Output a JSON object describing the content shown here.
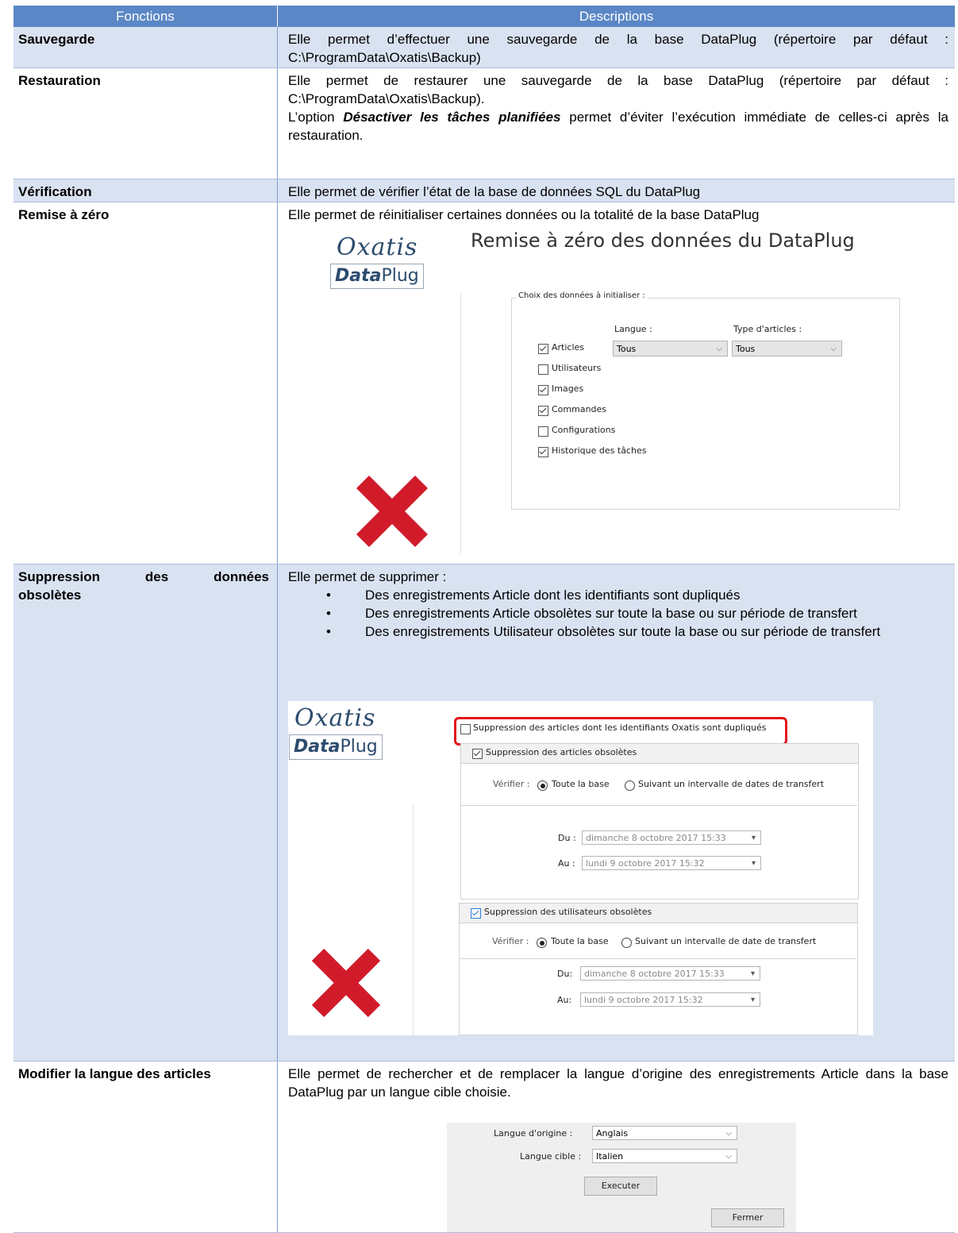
{
  "header": {
    "col1": "Fonctions",
    "col2": "Descriptions"
  },
  "rows": [
    {
      "function": "Sauvegarde",
      "lines": [
        "Elle permet d’effectuer une sauvegarde de la base DataPlug (répertoire par défaut : C:\\ProgramData\\Oxatis\\Backup)"
      ]
    },
    {
      "function": "Restauration",
      "p1": "Elle permet de restaurer une sauvegarde de la base DataPlug (répertoire par défaut : C:\\ProgramData\\Oxatis\\Backup).",
      "p2_before": "L’option ",
      "p2_em": "Désactiver les tâches planifiées",
      "p2_after": " permet d’éviter l’exécution immédiate de celles-ci après la restauration."
    },
    {
      "function": "Vérification",
      "text": "Elle permet de vérifier l’état de la base de données SQL du DataPlug"
    },
    {
      "function": "Remise à zéro",
      "text": "Elle permet de réinitialiser certaines données ou la totalité de la base DataPlug"
    },
    {
      "function_word1": "Suppression",
      "function_word2": "des",
      "function_word3": "données",
      "function_line2": "obsolètes",
      "intro": "Elle permet de supprimer :",
      "bullets": [
        "Des enregistrements Article dont les identifiants sont dupliqués",
        "Des enregistrements Article obsolètes sur toute la base ou sur période de transfert",
        "Des enregistrements Utilisateur obsolètes sur toute la base ou sur période de transfert"
      ]
    },
    {
      "function": "Modifier la langue des articles",
      "text": "Elle permet de rechercher et de remplacer la langue d’origine des enregistrements Article dans la base DataPlug par un langue cible choisie."
    }
  ],
  "logo": {
    "brand": "Oxatis",
    "product_bold": "Data",
    "product_rest": "Plug"
  },
  "reset_dialog": {
    "title": "Remise à zéro des données du DataPlug",
    "group_label": "Choix des données à initialiser :",
    "langue_label": "Langue :",
    "type_label": "Type d'articles :",
    "langue_value": "Tous",
    "type_value": "Tous",
    "items": [
      {
        "label": "Articles",
        "checked": true
      },
      {
        "label": "Utilisateurs",
        "checked": false
      },
      {
        "label": "Images",
        "checked": true
      },
      {
        "label": "Commandes",
        "checked": true
      },
      {
        "label": "Configurations",
        "checked": false
      },
      {
        "label": "Historique des tâches",
        "checked": true
      }
    ]
  },
  "purge_dialog": {
    "dup_label": "Suppression des articles dont les identifiants Oxatis sont dupliqués",
    "articles_label": "Suppression des articles obsolètes",
    "verifier1": "Vérifier :",
    "radio_all1": "Toute la base",
    "radio_interval1": "Suivant un intervalle de dates de transfert",
    "du1": "Du :",
    "au1": "Au :",
    "date_from1": "dimanche 8 octobre 2017 15:33",
    "date_to1": "lundi 9 octobre 2017 15:32",
    "users_label": "Suppression des utilisateurs obsolètes",
    "verifier2": "Vérifier :",
    "radio_all2": "Toute la base",
    "radio_interval2": "Suivant un intervalle de date de transfert",
    "du2": "Du:",
    "au2": "Au:",
    "date_from2": "dimanche 8 octobre 2017 15:33",
    "date_to2": "lundi 9 octobre 2017 15:32"
  },
  "lang_dialog": {
    "origin_label": "Langue d'origine :",
    "origin_value": "Anglais",
    "target_label": "Langue cible :",
    "target_value": "Italien",
    "execute": "Executer",
    "close": "Fermer"
  }
}
